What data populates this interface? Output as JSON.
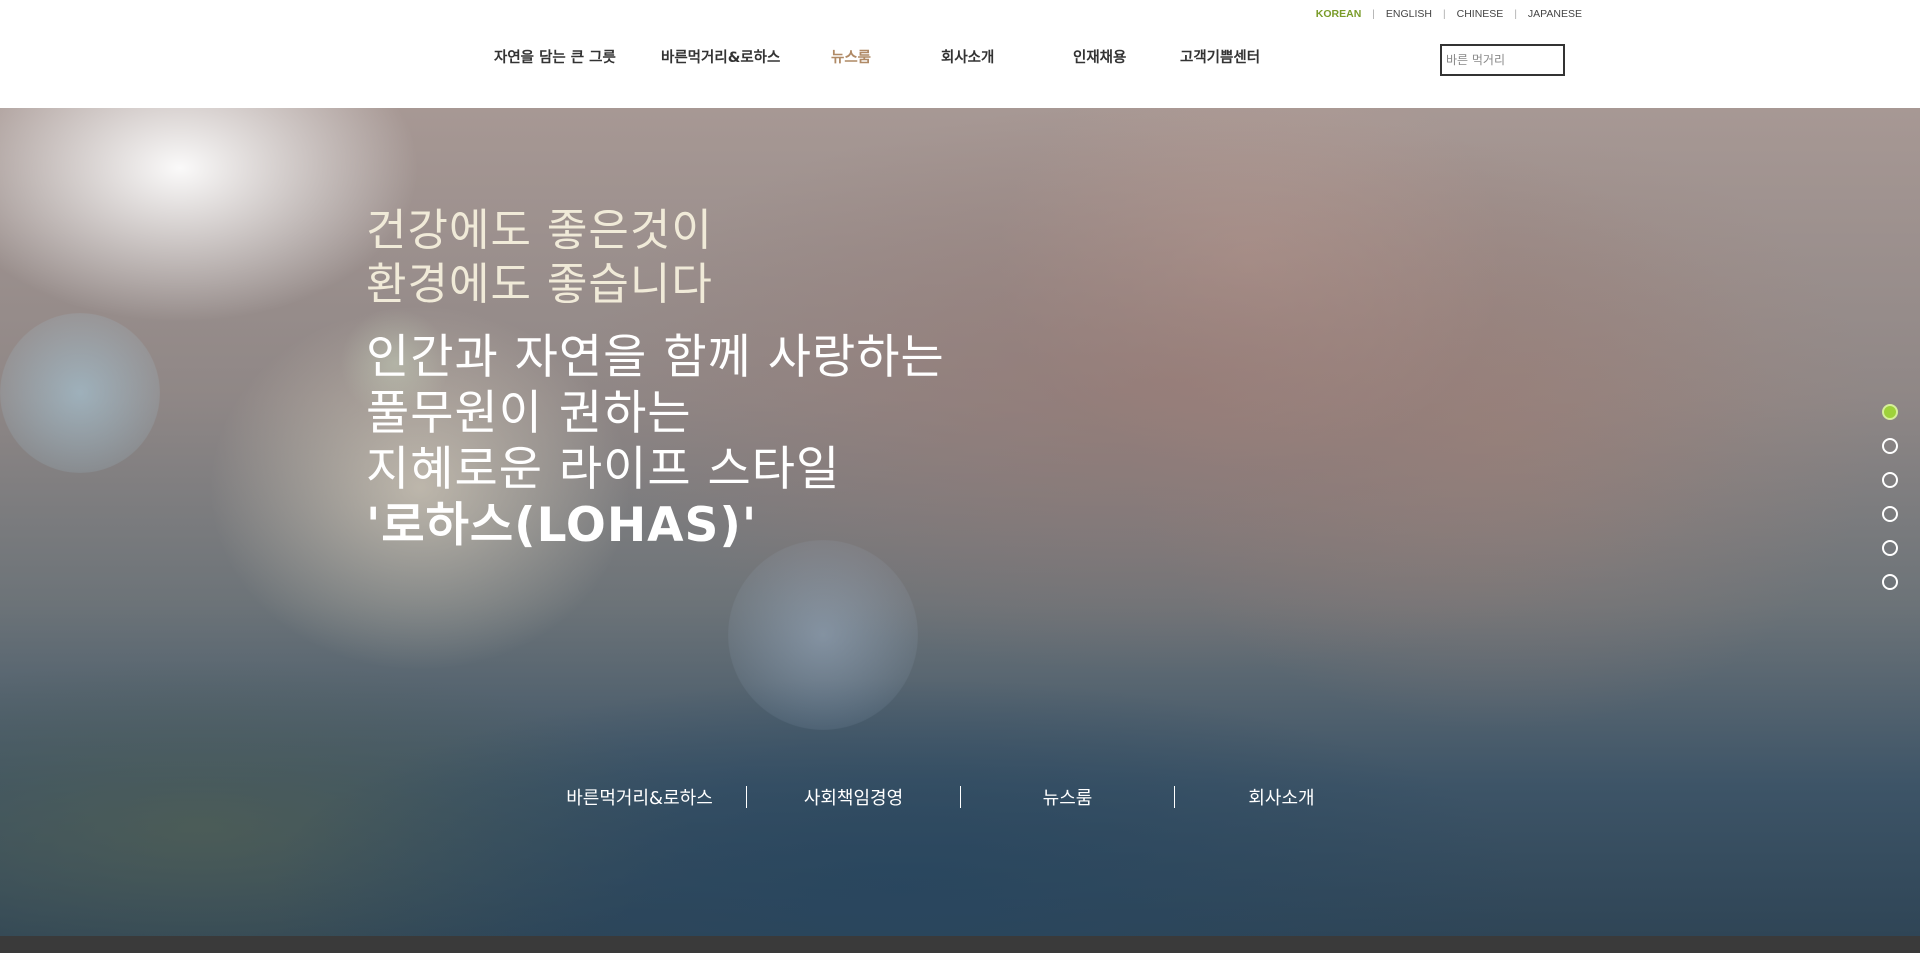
{
  "languages": [
    {
      "label": "KOREAN",
      "active": true
    },
    {
      "label": "ENGLISH",
      "active": false
    },
    {
      "label": "CHINESE",
      "active": false
    },
    {
      "label": "JAPANESE",
      "active": false
    }
  ],
  "lang_separator": "|",
  "nav": {
    "items": [
      {
        "label": "자연을 담는 큰 그릇",
        "active": false
      },
      {
        "label": "바른먹거리&로하스",
        "active": false
      },
      {
        "label": "뉴스룸",
        "active": true
      },
      {
        "label": "회사소개",
        "active": false
      },
      {
        "label": "인재채용",
        "active": false
      },
      {
        "label": "고객기쁨센터",
        "active": false
      }
    ],
    "active_color": "#b08a66"
  },
  "search": {
    "placeholder": "바른 먹거리",
    "value": ""
  },
  "hero": {
    "lead_lines": [
      "건강에도 좋은것이",
      "환경에도 좋습니다"
    ],
    "main_lines": [
      "인간과 자연을 함께 사랑하는",
      "풀무원이 권하는",
      "지혜로운 라이프 스타일"
    ],
    "highlight": "'로하스(LOHAS)'",
    "links": [
      "바른먹거리&로하스",
      "사회책임경영",
      "뉴스룸",
      "회사소개"
    ],
    "slides": {
      "count": 6,
      "active_index": 0
    },
    "accent_color": "#9ed23a"
  },
  "colors": {
    "lang_active": "#7a9c2a",
    "footer_bg": "#3a3a3a"
  }
}
